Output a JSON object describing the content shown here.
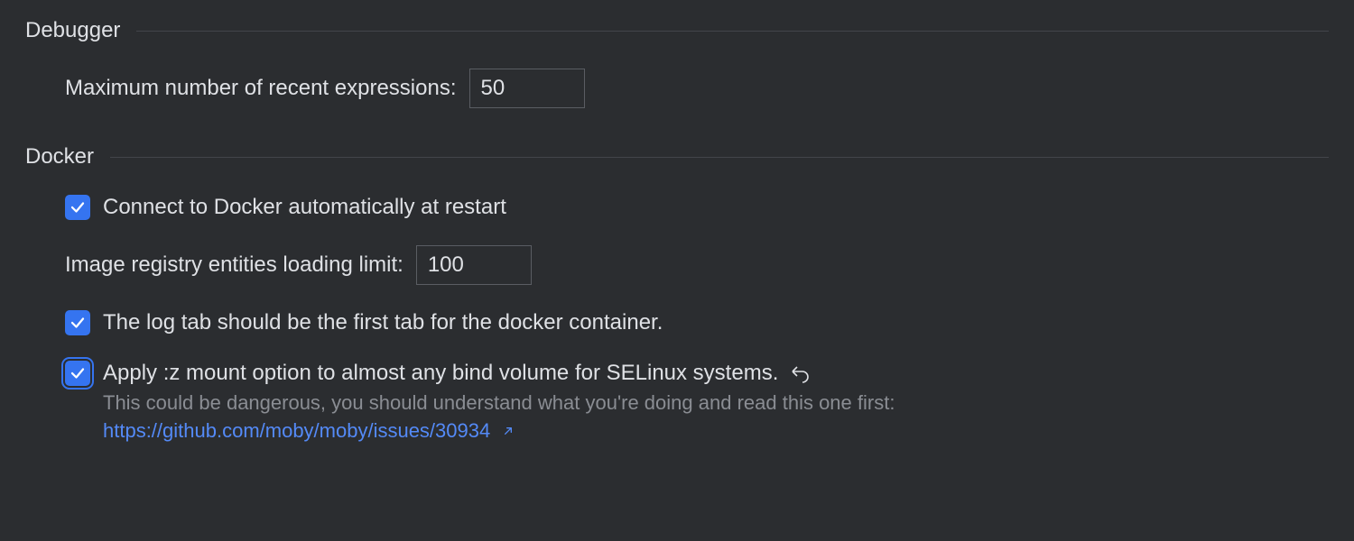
{
  "sections": {
    "debugger": {
      "title": "Debugger",
      "max_recent_expressions": {
        "label": "Maximum number of recent expressions:",
        "value": "50"
      }
    },
    "docker": {
      "title": "Docker",
      "connect_auto": {
        "label": "Connect to Docker automatically at restart",
        "checked": true
      },
      "registry_limit": {
        "label": "Image registry entities loading limit:",
        "value": "100"
      },
      "log_tab_first": {
        "label": "The log tab should be the first tab for the docker container.",
        "checked": true
      },
      "selinux_z_mount": {
        "label": "Apply :z mount option to almost any bind volume for SELinux systems.",
        "checked": true,
        "hint": "This could be dangerous, you should understand what you're doing and read this one first:",
        "link_text": "https://github.com/moby/moby/issues/30934"
      }
    }
  }
}
